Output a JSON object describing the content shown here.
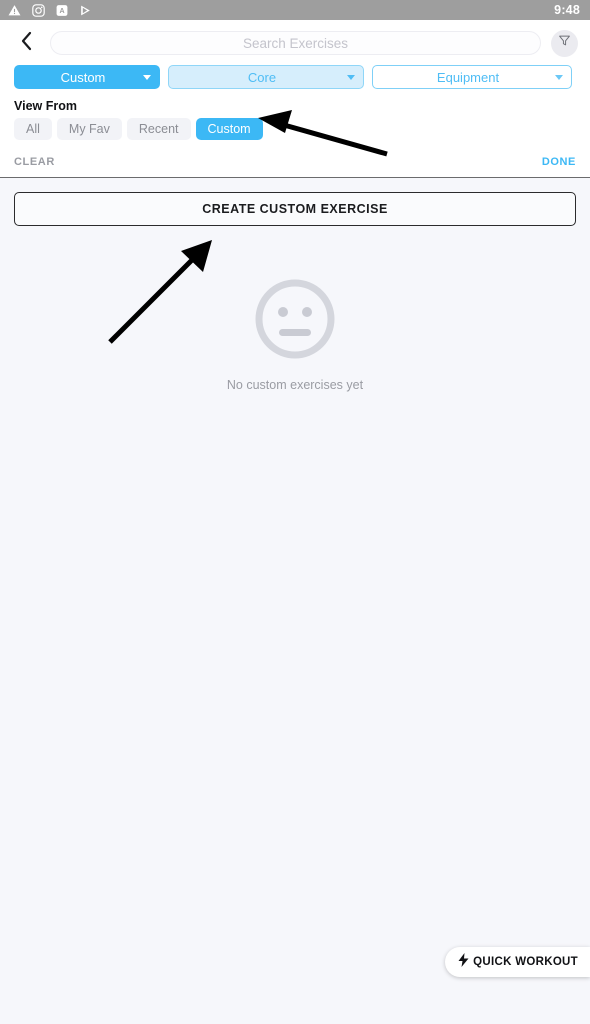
{
  "status_bar": {
    "time": "9:48",
    "icons": [
      "warning-triangle-icon",
      "camera-icon",
      "app-badge-icon",
      "play-icon"
    ],
    "background_color": "#9e9e9e"
  },
  "header": {
    "back_icon": "chevron-left-icon",
    "search": {
      "placeholder": "Search Exercises",
      "value": ""
    },
    "filter_icon": "funnel-icon"
  },
  "filters": {
    "dropdowns": [
      {
        "label": "Custom",
        "style": "primary",
        "caret_icon": "chevron-down-icon"
      },
      {
        "label": "Core",
        "style": "light",
        "caret_icon": "chevron-down-icon"
      },
      {
        "label": "Equipment",
        "style": "outline",
        "caret_icon": "chevron-down-icon"
      }
    ],
    "view_from_label": "View From",
    "segments": [
      {
        "label": "All",
        "selected": false
      },
      {
        "label": "My Fav",
        "selected": false
      },
      {
        "label": "Recent",
        "selected": false
      },
      {
        "label": "Custom",
        "selected": true
      }
    ],
    "clear_label": "CLEAR",
    "done_label": "DONE"
  },
  "main": {
    "create_button_label": "CREATE CUSTOM EXERCISE",
    "empty_state": {
      "icon": "neutral-face-icon",
      "text": "No custom exercises yet"
    }
  },
  "quick_workout": {
    "label": "QUICK WORKOUT",
    "icon": "lightning-bolt-icon"
  },
  "annotations": {
    "arrow_to_custom_segment": "arrow-pointing-left",
    "arrow_to_create_button": "arrow-pointing-up-right"
  },
  "colors": {
    "accent_blue": "#3cb8f5",
    "accent_blue_light": "#d6eefc",
    "page_background": "#f6f7fb",
    "status_bar": "#9e9e9e",
    "muted_text": "#9a9ca3"
  }
}
